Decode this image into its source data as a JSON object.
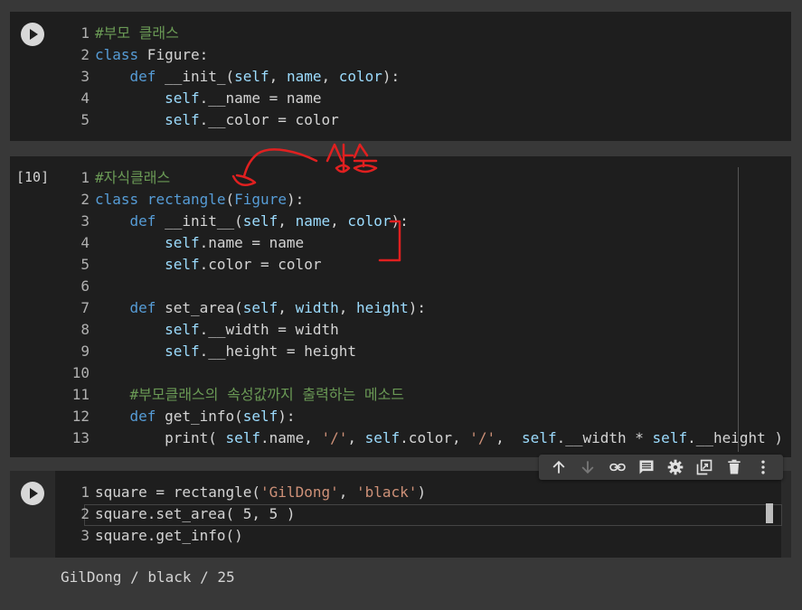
{
  "cell1": {
    "lines": [
      {
        "n": "1",
        "segments": [
          {
            "c": "cm",
            "t": "#부모 클래스"
          }
        ]
      },
      {
        "n": "2",
        "segments": [
          {
            "c": "kw",
            "t": "class"
          },
          {
            "c": "tx",
            "t": " Figure:"
          }
        ]
      },
      {
        "n": "3",
        "segments": [
          {
            "c": "tx",
            "t": "    "
          },
          {
            "c": "kw",
            "t": "def"
          },
          {
            "c": "tx",
            "t": " __init_("
          },
          {
            "c": "pr",
            "t": "self"
          },
          {
            "c": "tx",
            "t": ", "
          },
          {
            "c": "pr",
            "t": "name"
          },
          {
            "c": "tx",
            "t": ", "
          },
          {
            "c": "pr",
            "t": "color"
          },
          {
            "c": "tx",
            "t": "):"
          }
        ]
      },
      {
        "n": "4",
        "segments": [
          {
            "c": "tx",
            "t": "        "
          },
          {
            "c": "pr",
            "t": "self"
          },
          {
            "c": "tx",
            "t": ".__name = name"
          }
        ]
      },
      {
        "n": "5",
        "segments": [
          {
            "c": "tx",
            "t": "        "
          },
          {
            "c": "pr",
            "t": "self"
          },
          {
            "c": "tx",
            "t": ".__color = color"
          }
        ]
      }
    ]
  },
  "cell2": {
    "exec_count": "[10]",
    "lines": [
      {
        "n": "1",
        "segments": [
          {
            "c": "cm",
            "t": "#자식클래스"
          }
        ]
      },
      {
        "n": "2",
        "segments": [
          {
            "c": "kw",
            "t": "class"
          },
          {
            "c": "tx",
            "t": " "
          },
          {
            "c": "kw",
            "t": "rectangle"
          },
          {
            "c": "tx",
            "t": "("
          },
          {
            "c": "kw",
            "t": "Figure"
          },
          {
            "c": "tx",
            "t": "):"
          }
        ]
      },
      {
        "n": "3",
        "segments": [
          {
            "c": "tx",
            "t": "    "
          },
          {
            "c": "kw",
            "t": "def"
          },
          {
            "c": "tx",
            "t": " __init__("
          },
          {
            "c": "pr",
            "t": "self"
          },
          {
            "c": "tx",
            "t": ", "
          },
          {
            "c": "pr",
            "t": "name"
          },
          {
            "c": "tx",
            "t": ", "
          },
          {
            "c": "pr",
            "t": "color"
          },
          {
            "c": "tx",
            "t": "):"
          }
        ]
      },
      {
        "n": "4",
        "segments": [
          {
            "c": "tx",
            "t": "        "
          },
          {
            "c": "pr",
            "t": "self"
          },
          {
            "c": "tx",
            "t": ".name = name"
          }
        ]
      },
      {
        "n": "5",
        "segments": [
          {
            "c": "tx",
            "t": "        "
          },
          {
            "c": "pr",
            "t": "self"
          },
          {
            "c": "tx",
            "t": ".color = color"
          }
        ]
      },
      {
        "n": "6",
        "segments": []
      },
      {
        "n": "7",
        "segments": [
          {
            "c": "tx",
            "t": "    "
          },
          {
            "c": "kw",
            "t": "def"
          },
          {
            "c": "tx",
            "t": " set_area("
          },
          {
            "c": "pr",
            "t": "self"
          },
          {
            "c": "tx",
            "t": ", "
          },
          {
            "c": "pr",
            "t": "width"
          },
          {
            "c": "tx",
            "t": ", "
          },
          {
            "c": "pr",
            "t": "height"
          },
          {
            "c": "tx",
            "t": "):"
          }
        ]
      },
      {
        "n": "8",
        "segments": [
          {
            "c": "tx",
            "t": "        "
          },
          {
            "c": "pr",
            "t": "self"
          },
          {
            "c": "tx",
            "t": ".__width = width"
          }
        ]
      },
      {
        "n": "9",
        "segments": [
          {
            "c": "tx",
            "t": "        "
          },
          {
            "c": "pr",
            "t": "self"
          },
          {
            "c": "tx",
            "t": ".__height = height"
          }
        ]
      },
      {
        "n": "10",
        "segments": []
      },
      {
        "n": "11",
        "segments": [
          {
            "c": "tx",
            "t": "    "
          },
          {
            "c": "cm",
            "t": "#부모클래스의 속성값까지 출력하는 메소드"
          }
        ]
      },
      {
        "n": "12",
        "segments": [
          {
            "c": "tx",
            "t": "    "
          },
          {
            "c": "kw",
            "t": "def"
          },
          {
            "c": "tx",
            "t": " get_info("
          },
          {
            "c": "pr",
            "t": "self"
          },
          {
            "c": "tx",
            "t": "):"
          }
        ]
      },
      {
        "n": "13",
        "segments": [
          {
            "c": "tx",
            "t": "        "
          },
          {
            "c": "df",
            "t": "print"
          },
          {
            "c": "tx",
            "t": "( "
          },
          {
            "c": "pr",
            "t": "self"
          },
          {
            "c": "tx",
            "t": ".name, "
          },
          {
            "c": "st",
            "t": "'/'"
          },
          {
            "c": "tx",
            "t": ", "
          },
          {
            "c": "pr",
            "t": "self"
          },
          {
            "c": "tx",
            "t": ".color, "
          },
          {
            "c": "st",
            "t": "'/'"
          },
          {
            "c": "tx",
            "t": ",  "
          },
          {
            "c": "pr",
            "t": "self"
          },
          {
            "c": "tx",
            "t": ".__width * "
          },
          {
            "c": "pr",
            "t": "self"
          },
          {
            "c": "tx",
            "t": ".__height )"
          }
        ]
      }
    ]
  },
  "cell3": {
    "lines": [
      {
        "n": "1",
        "segments": [
          {
            "c": "tx",
            "t": "square = rectangle("
          },
          {
            "c": "st",
            "t": "'GilDong'"
          },
          {
            "c": "tx",
            "t": ", "
          },
          {
            "c": "st",
            "t": "'black'"
          },
          {
            "c": "tx",
            "t": ")"
          }
        ]
      },
      {
        "n": "2",
        "segments": [
          {
            "c": "tx",
            "t": "square.set_area( 5, 5 )"
          }
        ]
      },
      {
        "n": "3",
        "segments": [
          {
            "c": "tx",
            "t": "square.get_info()"
          }
        ]
      }
    ],
    "output": "GilDong / black / 25"
  },
  "annotation": {
    "handwritten_text": "상속",
    "color": "#e02020"
  },
  "toolbar": {
    "icons": [
      "arrow-up-icon",
      "arrow-down-icon",
      "link-icon",
      "comment-icon",
      "gear-icon",
      "mirror-cell-icon",
      "trash-icon",
      "more-vert-icon"
    ]
  }
}
